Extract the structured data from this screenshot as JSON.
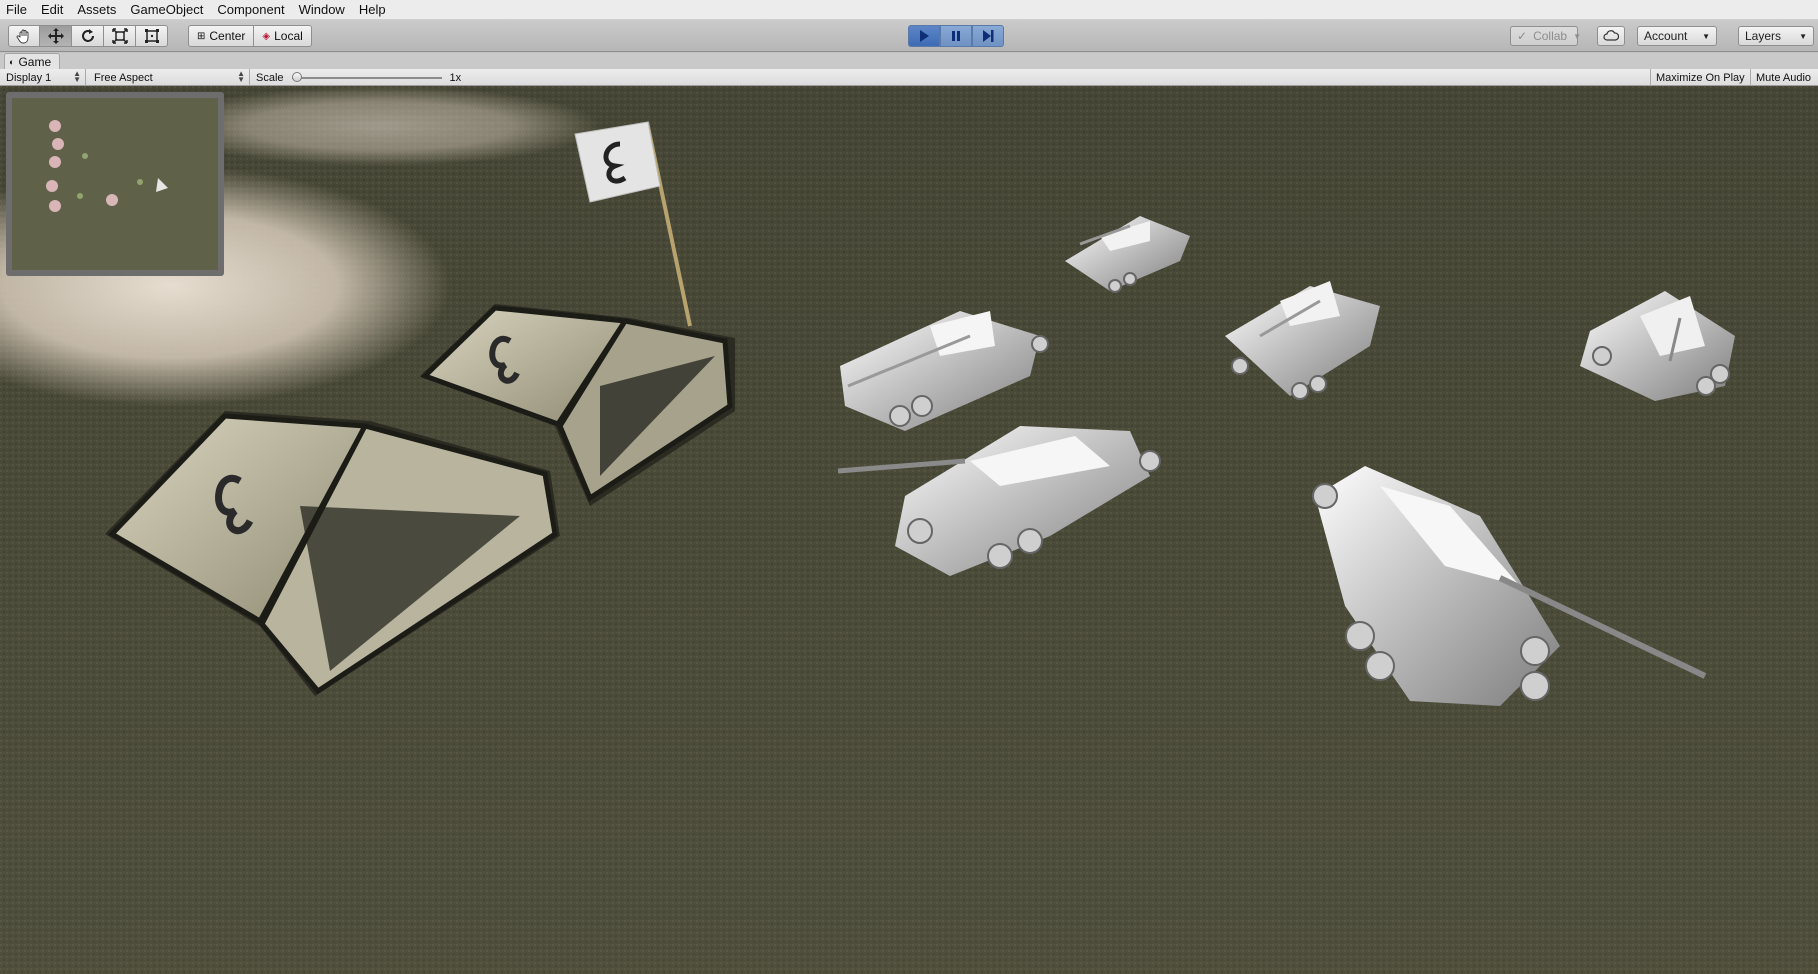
{
  "menu": [
    "File",
    "Edit",
    "Assets",
    "GameObject",
    "Component",
    "Window",
    "Help"
  ],
  "toolbar": {
    "tools": [
      "hand-tool-icon",
      "move-tool-icon",
      "rotate-tool-icon",
      "scale-tool-icon",
      "rect-tool-icon"
    ],
    "pivot_center": "Center",
    "pivot_local": "Local",
    "collab": "Collab",
    "account": "Account",
    "layers": "Layers"
  },
  "game": {
    "tab_title": "Game",
    "display": "Display 1",
    "aspect": "Free Aspect",
    "scale_label": "Scale",
    "scale_value": "1x",
    "maximize": "Maximize On Play",
    "mute": "Mute Audio"
  },
  "colors": {
    "ground": "#4b4a3a",
    "accent_play": "#3d6bb5",
    "tank": "#d9d9d9"
  }
}
